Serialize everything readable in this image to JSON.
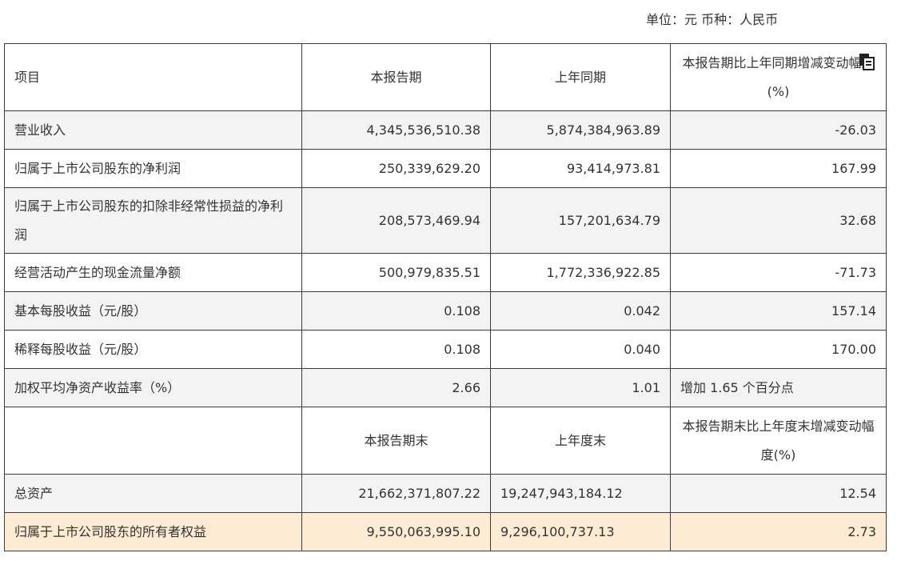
{
  "unit_note": "单位：元 币种：人民币",
  "header": {
    "col1": "项目",
    "col2": "本报告期",
    "col3": "上年同期",
    "col4": "本报告期比上年同期增减变动幅度(%)"
  },
  "rows": [
    {
      "label": "营业收入",
      "current": "4,345,536,510.38",
      "prior": "5,874,384,963.89",
      "change": "-26.03"
    },
    {
      "label": "归属于上市公司股东的净利润",
      "current": "250,339,629.20",
      "prior": "93,414,973.81",
      "change": "167.99"
    },
    {
      "label": "归属于上市公司股东的扣除非经常性损益的净利润",
      "current": "208,573,469.94",
      "prior": "157,201,634.79",
      "change": "32.68"
    },
    {
      "label": "经营活动产生的现金流量净额",
      "current": "500,979,835.51",
      "prior": "1,772,336,922.85",
      "change": "-71.73"
    },
    {
      "label": "基本每股收益（元/股）",
      "current": "0.108",
      "prior": "0.042",
      "change": "157.14"
    },
    {
      "label": "稀释每股收益（元/股）",
      "current": "0.108",
      "prior": "0.040",
      "change": "170.00"
    },
    {
      "label": "加权平均净资产收益率（%）",
      "current": "2.66",
      "prior": "1.01",
      "change": "增加 1.65 个百分点"
    }
  ],
  "header2": {
    "col2": "本报告期末",
    "col3": "上年度末",
    "col4": "本报告期末比上年度末增减变动幅度(%)"
  },
  "rows2": [
    {
      "label": "总资产",
      "current": "21,662,371,807.22",
      "prior": "19,247,943,184.12",
      "change": "12.54"
    },
    {
      "label": "归属于上市公司股东的所有者权益",
      "current": "9,550,063,995.10",
      "prior": "9,296,100,737.13",
      "change": "2.73"
    }
  ],
  "icons": {
    "copy": "copy-icon"
  },
  "colors": {
    "highlight_row": "#fdebd3",
    "shaded_row": "#f3f3f3",
    "border": "#3c3c3c"
  }
}
